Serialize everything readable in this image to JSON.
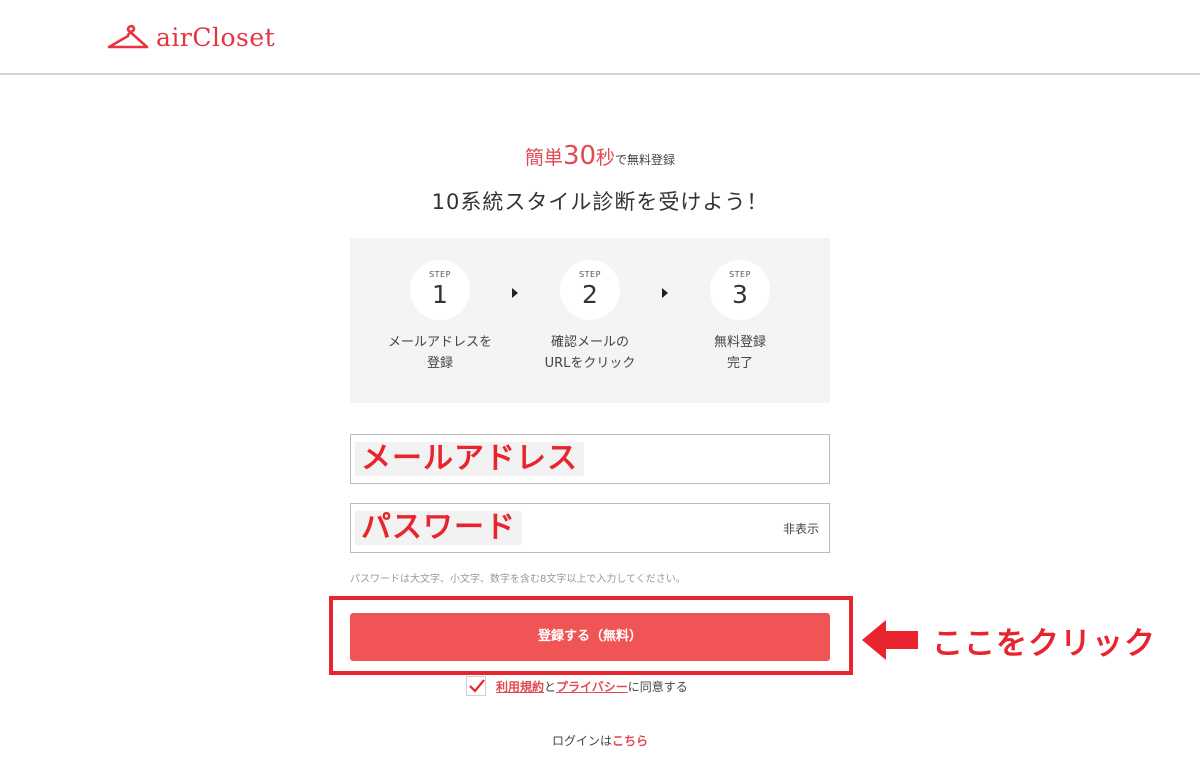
{
  "brand": {
    "name": "airCloset",
    "color": "#e53540"
  },
  "lead": {
    "prefix": "簡単",
    "number": "30",
    "unit": "秒",
    "suffix": "で無料登録"
  },
  "title": "10系統スタイル診断を受けよう！",
  "steps": [
    {
      "label": "STEP",
      "number": "1",
      "desc": "メールアドレスを\n登録"
    },
    {
      "label": "STEP",
      "number": "2",
      "desc": "確認メールの\nURLをクリック"
    },
    {
      "label": "STEP",
      "number": "3",
      "desc": "無料登録\n完了"
    }
  ],
  "form": {
    "email_overlay": "メールアドレス",
    "password_overlay": "パスワード",
    "password_toggle": "非表示",
    "hint": "パスワードは大文字、小文字、数字を含む8文字以上で入力してください。",
    "submit_label": "登録する（無料）"
  },
  "callout": {
    "text": "ここをクリック",
    "color": "#e8252e"
  },
  "agreement": {
    "checked": true,
    "terms_link": "利用規約",
    "connector": "と",
    "privacy_link": "プライバシー",
    "suffix": "に同意する"
  },
  "login": {
    "prefix": "ログインは",
    "link": "こちら"
  },
  "colors": {
    "accent": "#f15454",
    "highlight": "#e8252e",
    "panel": "#f4f4f4"
  }
}
